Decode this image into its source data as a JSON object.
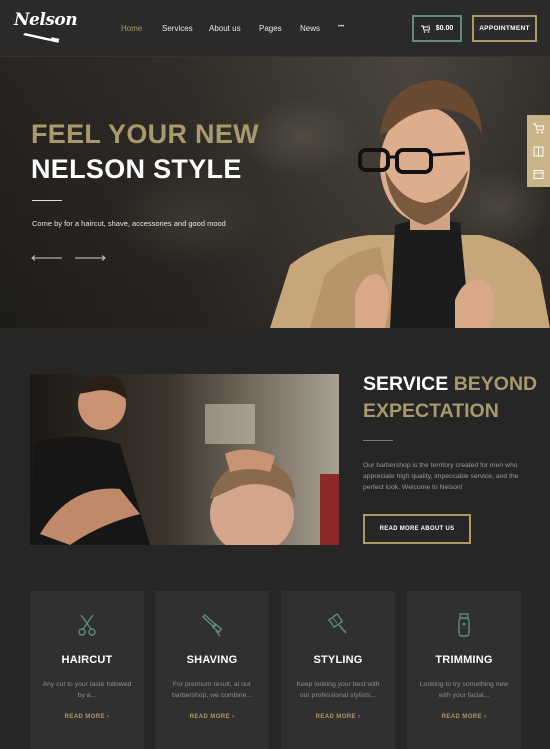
{
  "brand": {
    "logo_text": "Nelson"
  },
  "nav": {
    "items": [
      {
        "label": "Home",
        "active": true
      },
      {
        "label": "Services",
        "active": false
      },
      {
        "label": "About us",
        "active": false
      },
      {
        "label": "Pages",
        "active": false
      },
      {
        "label": "News",
        "active": false
      },
      {
        "label": "•••",
        "active": false
      }
    ]
  },
  "header": {
    "cart_total": "$0.00",
    "appointment_label": "Appointment"
  },
  "hero": {
    "title_line1": "FEEL YOUR NEW",
    "title_line2": "NELSON STYLE",
    "subtitle": "Come by for a haircut, shave, accessories and good mood"
  },
  "service": {
    "title_white": "SERVICE",
    "title_gold_1": "BEYOND",
    "title_gold_2": "EXPECTATION",
    "text": "Our barbershop is the territory created for men who appreciate high quality, impeccable service, and the perfect look. Welcome to Nelson!",
    "button_label": "READ MORE ABOUT US"
  },
  "cards": [
    {
      "icon": "scissors-icon",
      "title": "HAIRCUT",
      "desc": "Any cut to your taste followed by a...",
      "link": "READ MORE"
    },
    {
      "icon": "razor-icon",
      "title": "SHAVING",
      "desc": "For premium result, at our barbershop, we combine...",
      "link": "READ MORE"
    },
    {
      "icon": "brush-icon",
      "title": "STYLING",
      "desc": "Keep looking your best with our professional stylists...",
      "link": "READ MORE"
    },
    {
      "icon": "trimmer-icon",
      "title": "TRIMMING",
      "desc": "Looking to try something new with your facial...",
      "link": "READ MORE"
    }
  ],
  "colors": {
    "background": "#262626",
    "accent_gold": "#a89a6c",
    "accent_green": "#5e8c78",
    "card_bg": "#303030"
  }
}
